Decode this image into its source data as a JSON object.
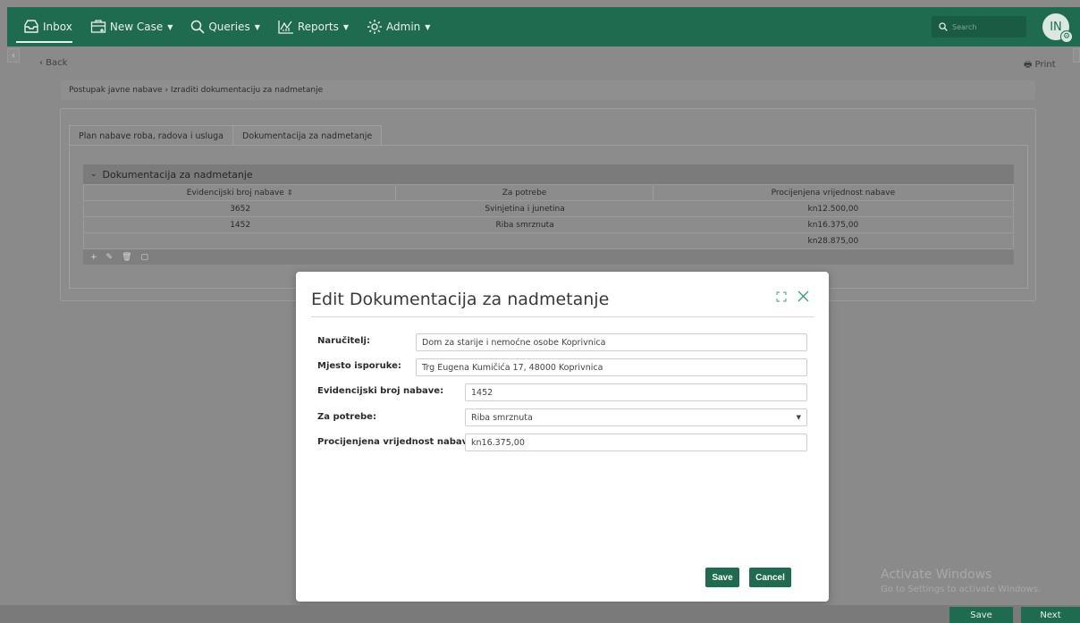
{
  "nav": {
    "inbox": "Inbox",
    "new_case": "New Case",
    "queries": "Queries",
    "reports": "Reports",
    "admin": "Admin",
    "search_placeholder": "Search",
    "avatar_initials": "IN"
  },
  "page": {
    "back": "‹ Back",
    "print": "Print",
    "breadcrumb": "Postupak javne nabave › Izraditi dokumentaciju za nadmetanje"
  },
  "tabs": [
    {
      "label": "Plan nabave roba, radova i usluga"
    },
    {
      "label": "Dokumentacija za nadmetanje"
    }
  ],
  "grid": {
    "title": "Dokumentacija za nadmetanje",
    "columns": [
      "Evidencijski broj nabave",
      "Za potrebe",
      "Procijenjena vrijednost nabave"
    ],
    "rows": [
      {
        "broj": "3652",
        "potrebe": "Svinjetina i junetina",
        "vrijednost": "kn12.500,00"
      },
      {
        "broj": "1452",
        "potrebe": "Riba smrznuta",
        "vrijednost": "kn16.375,00"
      }
    ],
    "total": "kn28.875,00"
  },
  "modal": {
    "title": "Edit Dokumentacija za nadmetanje",
    "fields": {
      "narucitelj_label": "Naručitelj:",
      "narucitelj_value": "Dom za starije i nemoćne osobe Koprivnica",
      "mjesto_label": "Mjesto isporuke:",
      "mjesto_value": "Trg Eugena Kumičića 17, 48000 Koprivnica",
      "broj_label": "Evidencijski broj nabave:",
      "broj_value": "1452",
      "potrebe_label": "Za potrebe:",
      "potrebe_value": "Riba smrznuta",
      "vrijednost_label": "Procijenjena vrijednost nabave:",
      "vrijednost_value": "kn16.375,00"
    },
    "save": "Save",
    "cancel": "Cancel"
  },
  "footer": {
    "save": "Save",
    "next": "Next"
  },
  "watermark": {
    "line1": "Activate Windows",
    "line2": "Go to Settings to activate Windows."
  },
  "colors": {
    "brand": "#1f6b4f",
    "accent_icon": "#3a9a86"
  }
}
